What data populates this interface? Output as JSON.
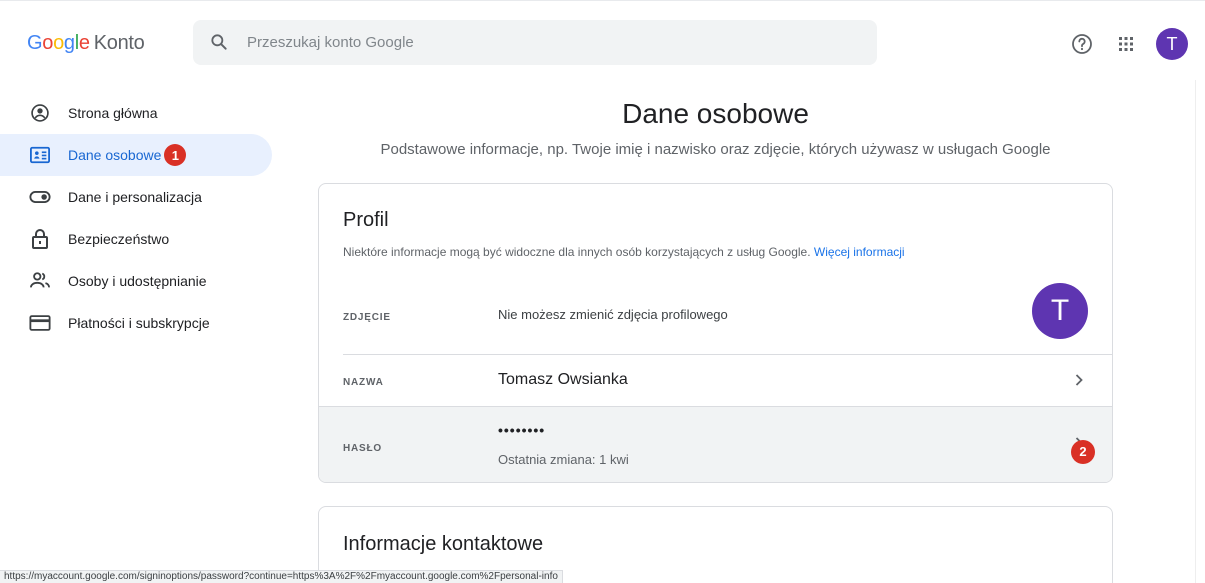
{
  "header": {
    "logo_google": [
      "G",
      "o",
      "o",
      "g",
      "l",
      "e"
    ],
    "logo_product": "Konto",
    "search_placeholder": "Przeszukaj konto Google",
    "avatar_letter": "T"
  },
  "sidebar": {
    "items": [
      {
        "label": "Strona główna",
        "icon": "person-circle-icon"
      },
      {
        "label": "Dane osobowe",
        "icon": "id-card-icon",
        "active": true,
        "badge": "1"
      },
      {
        "label": "Dane i personalizacja",
        "icon": "toggle-icon"
      },
      {
        "label": "Bezpieczeństwo",
        "icon": "lock-icon"
      },
      {
        "label": "Osoby i udostępnianie",
        "icon": "people-icon"
      },
      {
        "label": "Płatności i subskrypcje",
        "icon": "credit-card-icon"
      }
    ]
  },
  "main": {
    "title": "Dane osobowe",
    "subtitle": "Podstawowe informacje, np. Twoje imię i nazwisko oraz zdjęcie, których używasz w usługach Google",
    "profile_card": {
      "title": "Profil",
      "description": "Niektóre informacje mogą być widoczne dla innych osób korzystających z usług Google.",
      "more_link": "Więcej informacji",
      "photo_label": "ZDJĘCIE",
      "photo_value": "Nie możesz zmienić zdjęcia profilowego",
      "avatar_letter": "T",
      "name_label": "NAZWA",
      "name_value": "Tomasz Owsianka",
      "password_label": "HASŁO",
      "password_value": "••••••••",
      "password_changed": "Ostatnia zmiana: 1 kwi",
      "badge": "2"
    },
    "contact_card": {
      "title": "Informacje kontaktowe"
    }
  },
  "status_url": "https://myaccount.google.com/signinoptions/password?continue=https%3A%2F%2Fmyaccount.google.com%2Fpersonal-info",
  "colors": {
    "accent": "#1a73e8",
    "active_bg": "#e8f0fe",
    "avatar": "#5e35b1",
    "badge": "#d93025"
  }
}
